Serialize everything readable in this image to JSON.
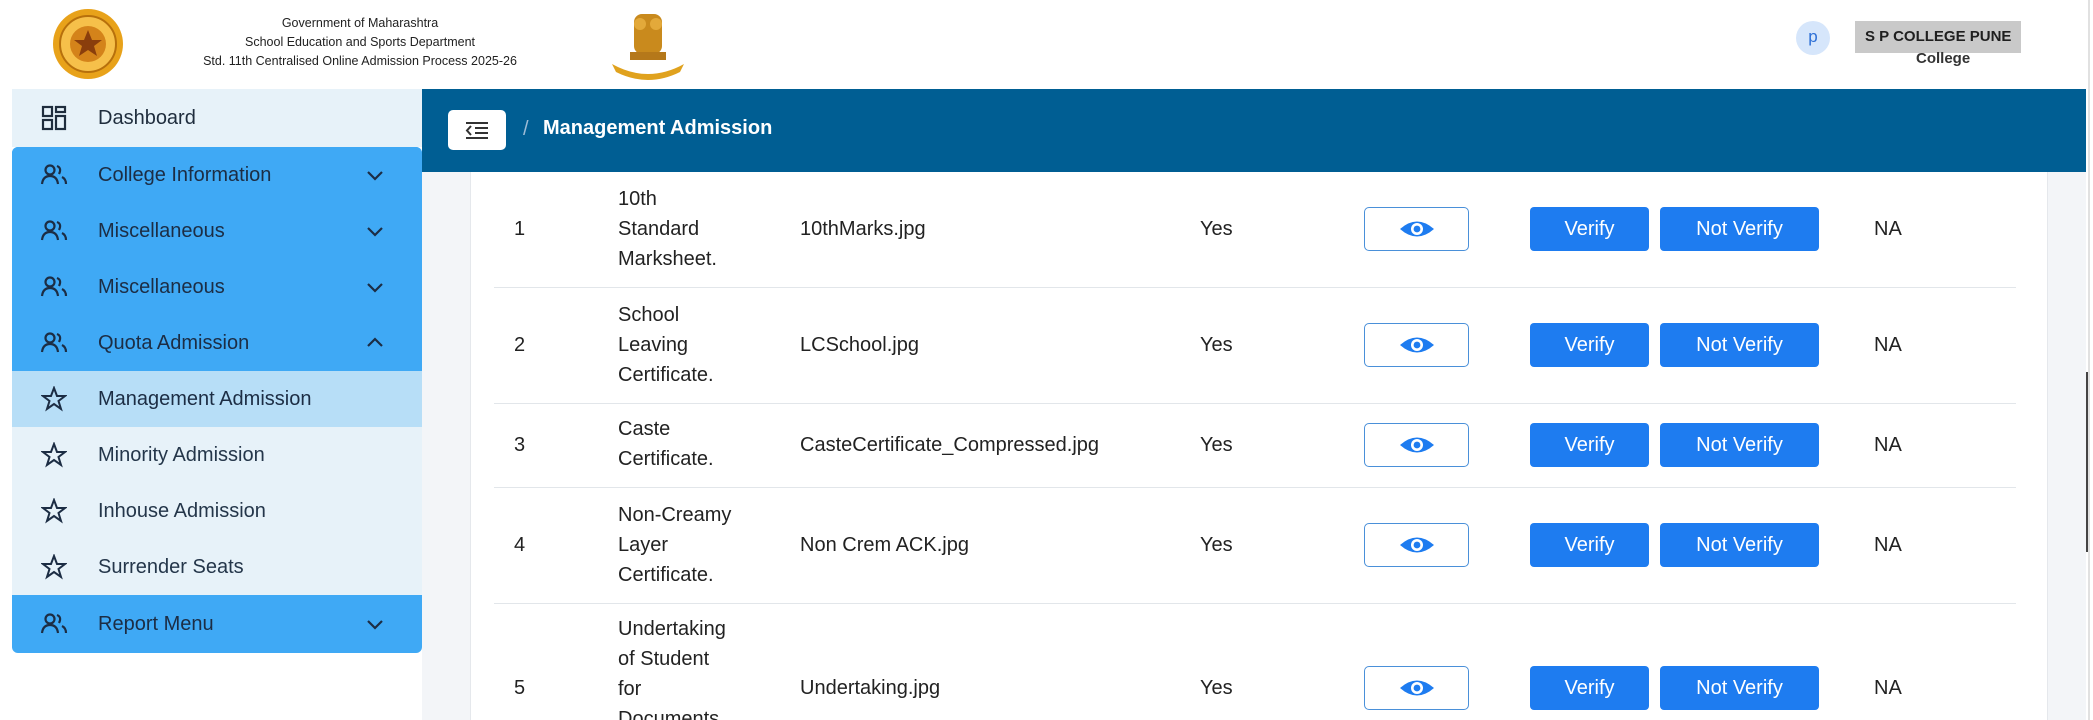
{
  "header": {
    "line1": "Government of Maharashtra",
    "line2": "School Education and Sports Department",
    "line3": "Std. 11th Centralised Online Admission Process 2025-26",
    "user_initial": "p",
    "college_name": "S P COLLEGE PUNE",
    "college_role": "College"
  },
  "sidebar": {
    "items": [
      {
        "label": "Dashboard",
        "icon": "dashboard-grid-icon"
      },
      {
        "label": "College Information",
        "icon": "users-icon",
        "chevron": "down"
      },
      {
        "label": "Miscellaneous",
        "icon": "users-icon",
        "chevron": "down"
      },
      {
        "label": "Miscellaneous",
        "icon": "users-icon",
        "chevron": "down"
      },
      {
        "label": "Quota Admission",
        "icon": "users-icon",
        "chevron": "up"
      },
      {
        "label": "Management Admission",
        "icon": "star-icon"
      },
      {
        "label": "Minority Admission",
        "icon": "star-icon"
      },
      {
        "label": "Inhouse Admission",
        "icon": "star-icon"
      },
      {
        "label": "Surrender Seats",
        "icon": "star-icon"
      },
      {
        "label": "Report Menu",
        "icon": "users-icon",
        "chevron": "down"
      }
    ]
  },
  "topbar": {
    "separator": "/",
    "title": "Management Admission"
  },
  "table": {
    "verify_label": "Verify",
    "not_verify_label": "Not Verify",
    "rows": [
      {
        "no": "1",
        "doc": [
          "10th",
          "Standard",
          "Marksheet."
        ],
        "file": "10thMarks.jpg",
        "uploaded": "Yes",
        "status": "NA"
      },
      {
        "no": "2",
        "doc": [
          "School",
          "Leaving",
          "Certificate."
        ],
        "file": "LCSchool.jpg",
        "uploaded": "Yes",
        "status": "NA"
      },
      {
        "no": "3",
        "doc": [
          "Caste",
          "Certificate."
        ],
        "file": "CasteCertificate_Compressed.jpg",
        "uploaded": "Yes",
        "status": "NA"
      },
      {
        "no": "4",
        "doc": [
          "Non-Creamy",
          "Layer",
          "Certificate."
        ],
        "file": "Non Crem ACK.jpg",
        "uploaded": "Yes",
        "status": "NA"
      },
      {
        "no": "5",
        "doc": [
          "Undertaking",
          "of Student",
          "for",
          "Documents"
        ],
        "file": "Undertaking.jpg",
        "uploaded": "Yes",
        "status": "NA"
      }
    ]
  },
  "colors": {
    "sidebar_blue": "#3fa9f5",
    "sidebar_active": "#b7def7",
    "topbar": "#005e93",
    "button": "#1e7cf0"
  }
}
